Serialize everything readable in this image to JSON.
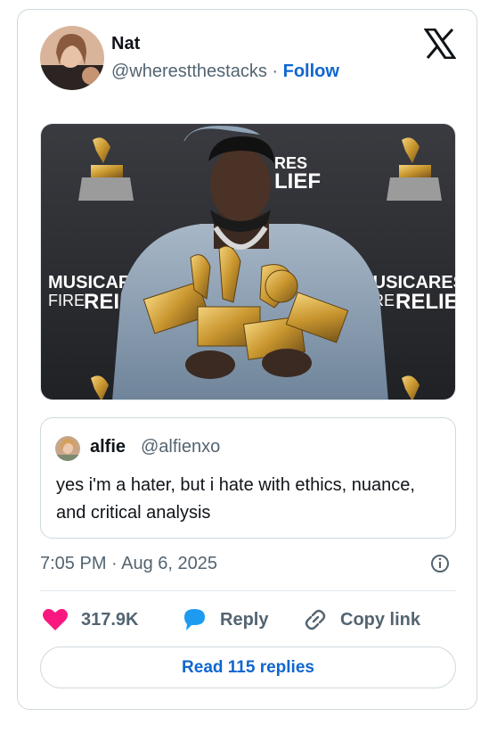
{
  "author": {
    "name": "Nat",
    "handle": "@wherestthestacks",
    "separator": "·",
    "follow_label": "Follow"
  },
  "photo": {
    "backdrop_text_left_1": "MUSICAR",
    "backdrop_text_left_2": "FIRE",
    "backdrop_text_left_3": "REI",
    "backdrop_text_right_1": "MUSICARES",
    "backdrop_text_right_2": "FIRE",
    "backdrop_text_right_3": "RELIE",
    "backdrop_text_top_1": "RES",
    "backdrop_text_top_2": "LIEF"
  },
  "quote": {
    "name": "alfie",
    "handle": "@alfienxo",
    "text": "yes i'm a hater, but i hate with ethics, nuance, and critical analysis"
  },
  "meta": {
    "timestamp": "7:05 PM · Aug 6, 2025"
  },
  "actions": {
    "likes": "317.9K",
    "reply": "Reply",
    "copy_link": "Copy link"
  },
  "read_replies": "Read 115 replies",
  "colors": {
    "accent": "#0f66d0",
    "like": "#f91880",
    "reply_bubble": "#1d9bf0",
    "muted": "#536471"
  }
}
